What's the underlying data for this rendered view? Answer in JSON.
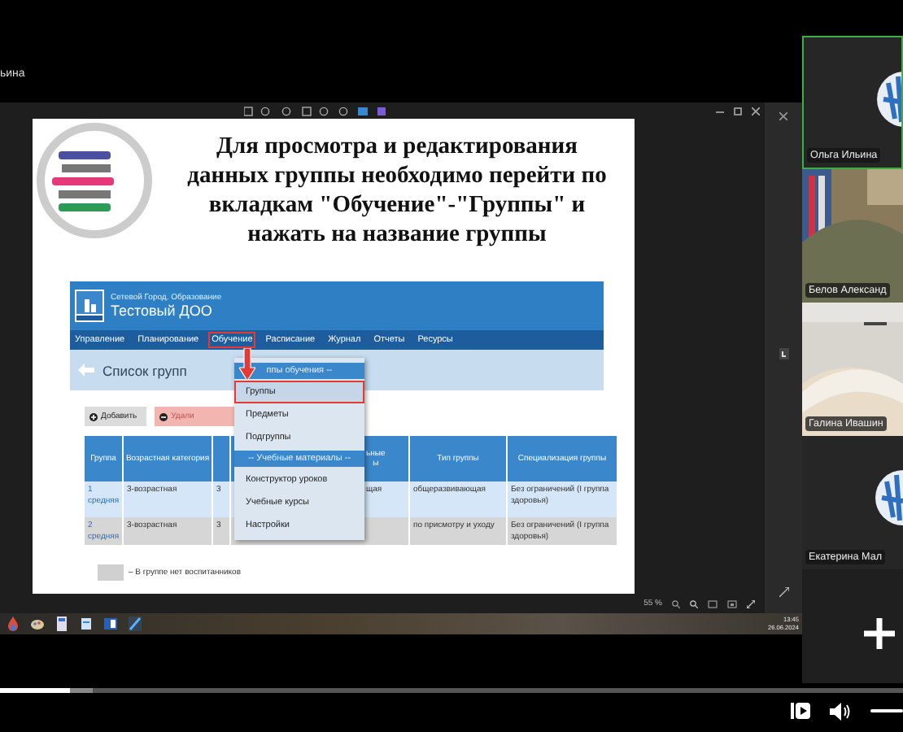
{
  "corner_label": "ьина",
  "share_window": {
    "zoom": "55 %",
    "clock": {
      "time": "13:45",
      "date": "26.06.2024"
    }
  },
  "slide": {
    "title": "Для просмотра и редактирования данных группы необходимо перейти по вкладкам \"Обучение\"-\"Группы\" и нажать на название группы",
    "app": {
      "product": "Сетевой Город. Образование",
      "org": "Тестовый ДОО",
      "nav": [
        {
          "label": "Управление",
          "selected": false
        },
        {
          "label": "Планирование",
          "selected": false
        },
        {
          "label": "Обучение",
          "selected": true
        },
        {
          "label": "Расписание",
          "selected": false
        },
        {
          "label": "Журнал",
          "selected": false
        },
        {
          "label": "Отчеты",
          "selected": false
        },
        {
          "label": "Ресурсы",
          "selected": false
        }
      ],
      "page_title": "Список групп",
      "buttons": [
        {
          "label": "Добавить",
          "kind": "add"
        },
        {
          "label": "Удали",
          "kind": "delete"
        }
      ],
      "table": {
        "columns": [
          "Группа",
          "Возрастная категория",
          null,
          "ьные\nы",
          "Тип группы",
          "Специализация группы"
        ],
        "rows": [
          {
            "empty": false,
            "cells": [
              "1 средняя",
              "3-возрастная",
              "3",
              "щая",
              "общеразвивающая",
              "Без ограничений (I группа здоровья)"
            ]
          },
          {
            "empty": true,
            "cells": [
              "2 средняя",
              "3-возрастная",
              "3",
              null,
              "по присмотру и уходу",
              "Без ограничений (I группа здоровья)"
            ]
          }
        ]
      },
      "menu": [
        {
          "kind": "header",
          "label": "ппы обучения --"
        },
        {
          "kind": "item",
          "label": "Группы",
          "selected": true
        },
        {
          "kind": "item",
          "label": "Предметы",
          "selected": false
        },
        {
          "kind": "item",
          "label": "Подгруппы",
          "selected": false
        },
        {
          "kind": "header",
          "label": "-- Учебные материалы --"
        },
        {
          "kind": "item",
          "label": "Конструктор уроков",
          "selected": false
        },
        {
          "kind": "item",
          "label": "Учебные курсы",
          "selected": false
        },
        {
          "kind": "item",
          "label": "Настройки",
          "selected": false
        }
      ],
      "legend": "– В группе нет воспитанников"
    }
  },
  "participants": [
    {
      "name": "Ольга Ильина",
      "kind": "avatar",
      "speaking": true
    },
    {
      "name": "Белов Александ",
      "kind": "video",
      "speaking": false
    },
    {
      "name": "Галина Ивашин",
      "kind": "video",
      "speaking": false
    },
    {
      "name": "Екатерина Мал",
      "kind": "avatar",
      "speaking": false
    }
  ],
  "player": {
    "progress": {
      "level": 0.078
    },
    "volume": {
      "level": 1
    }
  }
}
